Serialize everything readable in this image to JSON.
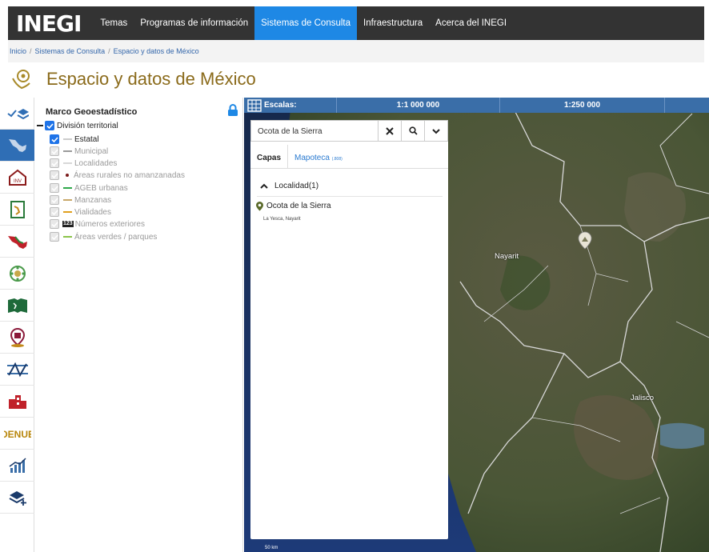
{
  "nav": {
    "logo": "INEGI",
    "items": [
      "Temas",
      "Programas de información",
      "Sistemas de Consulta",
      "Infraestructura",
      "Acerca del INEGI"
    ],
    "active_index": 2
  },
  "breadcrumb": [
    "Inicio",
    "Sistemas de Consulta",
    "Espacio y datos de México"
  ],
  "page_title": "Espacio y datos de México",
  "layer_tree": {
    "heading": "Marco Geoestadístico",
    "root": "División territorial",
    "items": [
      {
        "label": "Estatal",
        "checked": true,
        "swatch": "#cccccc"
      },
      {
        "label": "Municipal",
        "checked": false,
        "swatch": "#9a9a9a"
      },
      {
        "label": "Localidades",
        "checked": false,
        "swatch": "#d8d8d8"
      },
      {
        "label": "Áreas rurales no amanzanadas",
        "checked": false,
        "swatch": "#7a1a1a"
      },
      {
        "label": "AGEB urbanas",
        "checked": false,
        "swatch": "#2ea84a"
      },
      {
        "label": "Manzanas",
        "checked": false,
        "swatch": "#c9a86a"
      },
      {
        "label": "Vialidades",
        "checked": false,
        "swatch": "#e0a020"
      },
      {
        "label": "Números exteriores",
        "checked": false,
        "swatch": "#222222",
        "icon_text": "123"
      },
      {
        "label": "Áreas verdes / parques",
        "checked": false,
        "swatch": "#8bc34a"
      }
    ]
  },
  "map": {
    "scales": {
      "label": "Escalas:",
      "values": [
        "1:1 000 000",
        "1:250 000"
      ]
    },
    "search_value": "Ocota de la Sierra",
    "tabs": {
      "capas": "Capas",
      "mapoteca": "Mapoteca",
      "mapoteca_count": "(.808)"
    },
    "group": "Localidad(1)",
    "result_name": "Ocota de la Sierra",
    "result_sub": "La Yesca, Nayarit",
    "labels": {
      "nayarit": "Nayarit",
      "jalisco": "Jalisco"
    },
    "scale_text": "50 km"
  },
  "colors": {
    "nav_bg": "#333333",
    "nav_active": "#1e88e5",
    "title": "#8a6a1a",
    "scalebar": "#3a6ea8",
    "rail_active": "#2f6eb5"
  }
}
